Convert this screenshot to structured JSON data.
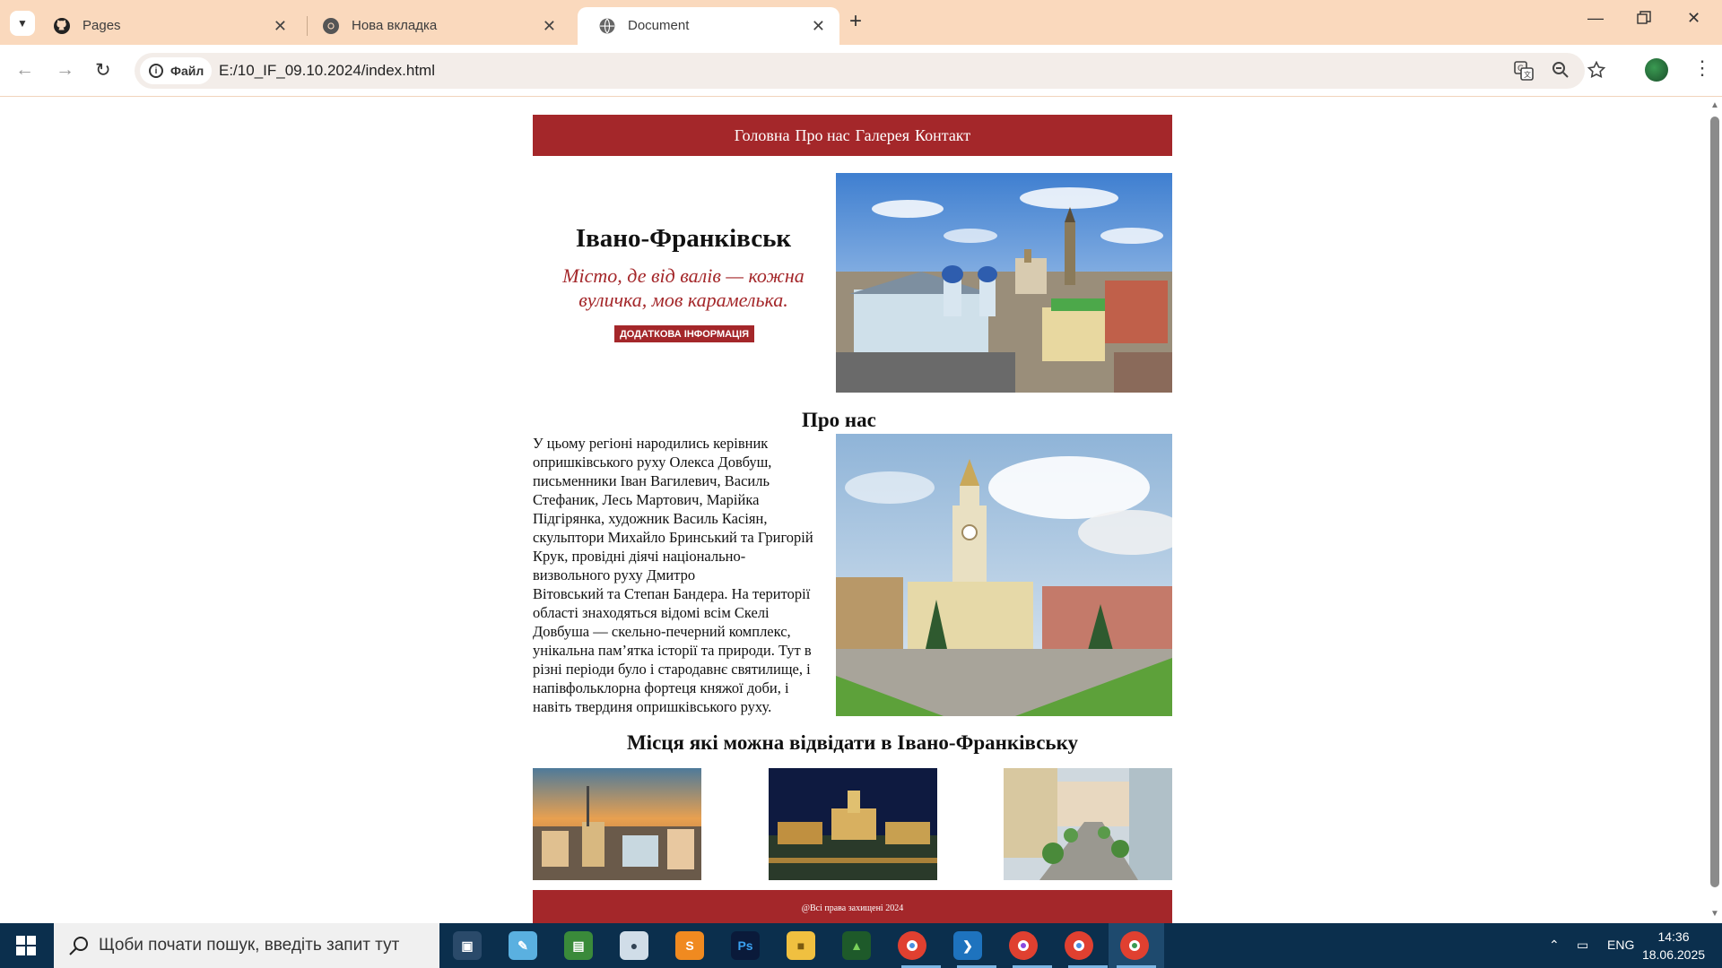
{
  "browser": {
    "tabs": [
      {
        "label": "Pages",
        "icon": "github-icon"
      },
      {
        "label": "Нова вкладка",
        "icon": "chrome-icon"
      },
      {
        "label": "Document",
        "icon": "globe-icon"
      }
    ],
    "active_tab": 2,
    "address_chip": "Файл",
    "url": "E:/10_IF_09.10.2024/index.html"
  },
  "site": {
    "nav": [
      "Головна",
      "Про нас",
      "Галерея",
      "Контакт"
    ],
    "hero": {
      "title": "Івано-Франківськ",
      "subtitle": "Місто, де від валів — кожна вуличка, мов карамелька.",
      "button": "ДОДАТКОВА ІНФОРМАЦІЯ"
    },
    "about": {
      "title": "Про нас",
      "text_lines": [
        "У цьому регіоні народились керівник",
        "опришківського руху Олекса Довбуш,",
        "письменники Іван Вагилевич, Василь",
        "Стефаник, Лесь Мартович, Марійка",
        "Підгірянка, художник Василь Касіян,",
        "скульптори Михайло Бринський та Григорій",
        "Крук, провідні діячі національно-",
        "визвольного руху Дмитро",
        "Вітовський та Степан Бандера. На території",
        "області знаходяться відомі всім Скелі",
        "Довбуша — скельно-печерний комплекс,",
        "унікальна пам’ятка історії та природи.  Тут в",
        "різні періоди було і стародавнє святилище, і",
        "напівфольклорна фортеця княжої доби, і",
        "навіть твердиня опришківського руху."
      ]
    },
    "places_title": "Місця які можна відвідати в Івано-Франківську",
    "footer": "@Всі права захищені 2024",
    "accent": "#a4272a"
  },
  "taskbar": {
    "search_placeholder": "Щоби почати пошук, введіть запит тут",
    "lang": "ENG",
    "time": "14:36",
    "date": "18.06.2025",
    "apps": [
      "photos-icon",
      "notepad-icon",
      "spreadsheet-icon",
      "disk-icon",
      "sublime-icon",
      "photoshop-icon",
      "explorer-icon",
      "tree-icon",
      "chrome-icon",
      "vscode-icon",
      "chrome-profile-icon",
      "chrome-profile2-icon",
      "chrome-active-icon"
    ]
  }
}
